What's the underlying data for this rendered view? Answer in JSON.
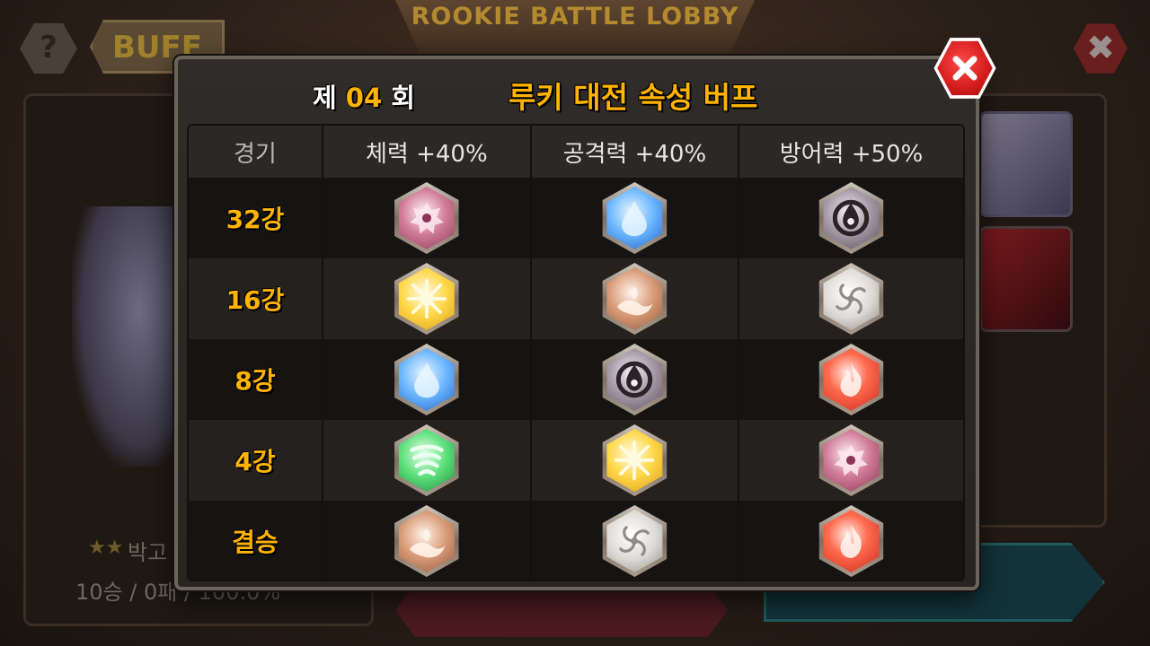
{
  "background": {
    "title": "ROOKIE BATTLE LOBBY",
    "help_label": "?",
    "buff_label": "BUFF",
    "close_label": "✖",
    "hero_name_fragment": "박고",
    "record_fragment": "10승 / 0패 / 100.0%"
  },
  "modal": {
    "round_prefix": "제 ",
    "round_number": "04",
    "round_suffix": " 회",
    "title": "루키 대전 속성 버프",
    "columns": [
      "경기",
      "체력 +40%",
      "공격력 +40%",
      "방어력 +50%"
    ],
    "rows": [
      {
        "stage": "32강",
        "buffs": [
          "fiend-element-icon",
          "water-element-icon",
          "dark-element-icon"
        ]
      },
      {
        "stage": "16강",
        "buffs": [
          "light-element-icon",
          "earth-element-icon",
          "void-element-icon"
        ]
      },
      {
        "stage": "8강",
        "buffs": [
          "water-element-icon",
          "dark-element-icon",
          "fire-element-icon"
        ]
      },
      {
        "stage": "4강",
        "buffs": [
          "wind-element-icon",
          "light-element-icon",
          "fiend-element-icon"
        ]
      },
      {
        "stage": "결승",
        "buffs": [
          "earth-element-icon",
          "void-element-icon",
          "fire-element-icon"
        ]
      }
    ]
  },
  "colors": {
    "accent_gold": "#ffb400",
    "close_red": "#d41c1c",
    "panel_dark": "#2f2c2a"
  }
}
